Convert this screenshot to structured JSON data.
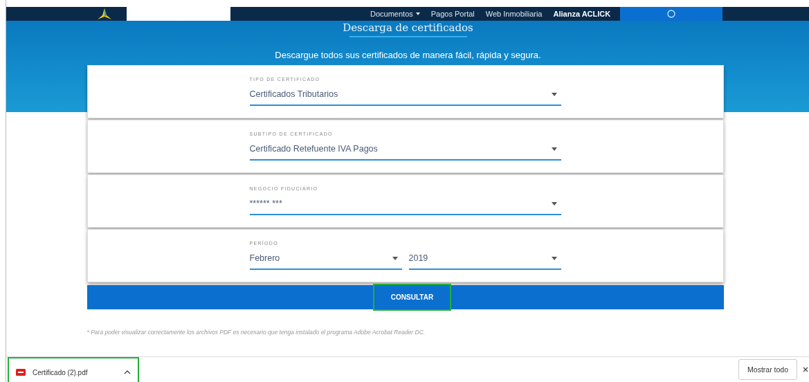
{
  "nav": {
    "links": [
      {
        "label": "Documentos",
        "kind": "dropdown"
      },
      {
        "label": "Pagos Portal",
        "kind": "link"
      },
      {
        "label": "Web Inmobiliaria",
        "kind": "link"
      },
      {
        "label": "Alianza ACLICK",
        "kind": "brand"
      }
    ]
  },
  "hero": {
    "title": "Descarga de certificados",
    "subtitle": "Descargue todos sus certificados de manera fácil, rápida y segura."
  },
  "form": {
    "rows": [
      {
        "label": "TIPO DE CERTIFICADO",
        "fields": [
          {
            "value": "Certificados Tributarios"
          }
        ]
      },
      {
        "label": "SUBTIPO DE CERTIFICADO",
        "fields": [
          {
            "value": "Certificado Retefuente IVA Pagos"
          }
        ]
      },
      {
        "label": "NEGOCIO FIDUCIARIO",
        "fields": [
          {
            "value": "****** ***"
          }
        ]
      },
      {
        "label": "PERÍODO",
        "fields": [
          {
            "value": "Febrero"
          },
          {
            "value": "2019"
          }
        ]
      }
    ],
    "submit": {
      "label": "CONSULTAR",
      "highlighted": true
    }
  },
  "note": "* Para poder visualizar correctamente los archivos PDF es necesario que tenga instalado el programa Adobe Acrobat Reader DC.",
  "downloads": {
    "items": [
      {
        "name": "Certificado (2).pdf",
        "highlighted": true
      }
    ],
    "show_all": "Mostrar todo"
  }
}
